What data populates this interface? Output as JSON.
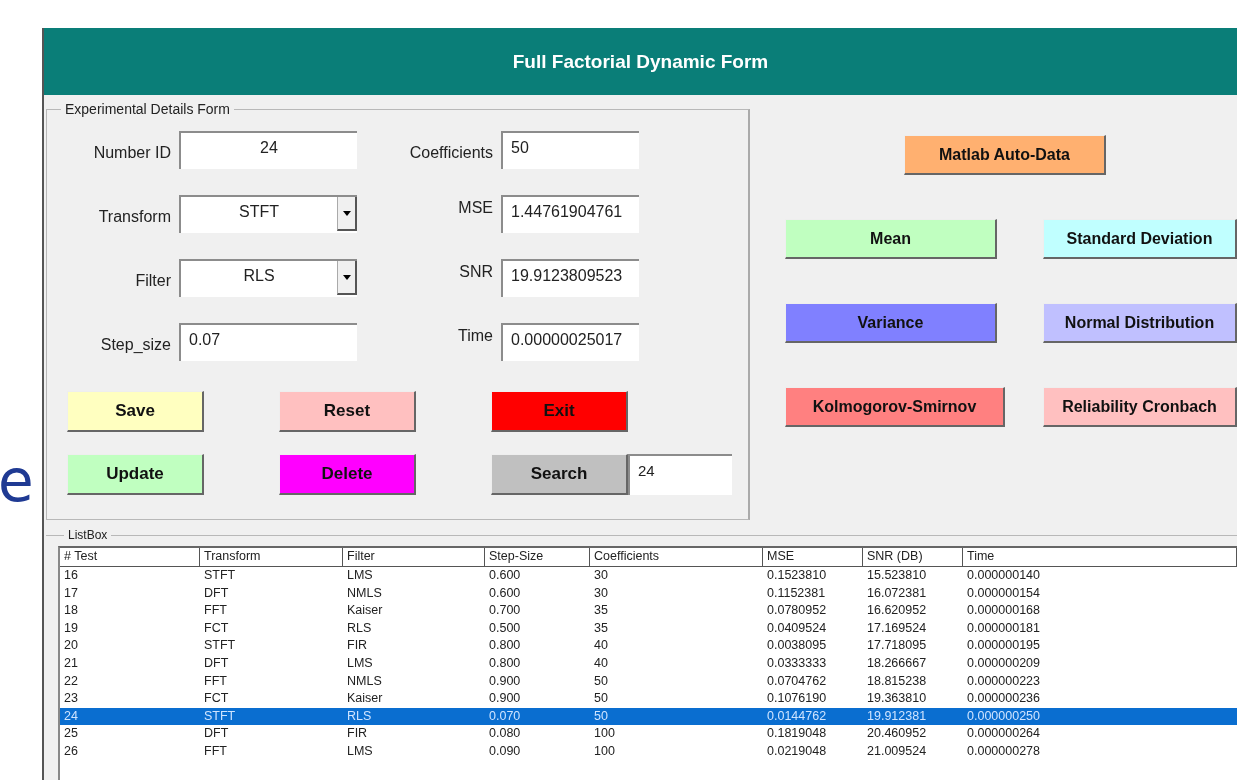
{
  "background_fragment": "e",
  "window": {
    "title": "Full Factorial Dynamic Form"
  },
  "form": {
    "legend": "Experimental Details Form",
    "fields": [
      {
        "label": "Number ID",
        "kind": "centered",
        "value": "24"
      },
      {
        "label": "Coefficients",
        "kind": "text",
        "value": "50"
      },
      {
        "label": "Transform",
        "kind": "dropdown",
        "value": "STFT"
      },
      {
        "label": "MSE",
        "kind": "text",
        "value": "1.44761904761"
      },
      {
        "label": "Filter",
        "kind": "dropdown",
        "value": "RLS"
      },
      {
        "label": "SNR",
        "kind": "text",
        "value": "19.9123809523"
      },
      {
        "label": "Step_size",
        "kind": "text",
        "value": "0.07"
      },
      {
        "label": "Time",
        "kind": "text",
        "value": "0.00000025017"
      }
    ],
    "buttons": [
      {
        "label": "Save",
        "color": "#ffffc0"
      },
      {
        "label": "Reset",
        "color": "#ffc0c0"
      },
      {
        "label": "Exit",
        "color": "#ff0000"
      },
      {
        "label": "Update",
        "color": "#c0ffc0"
      },
      {
        "label": "Delete",
        "color": "#ff00ff"
      },
      {
        "label": "Search",
        "color": "#c0c0c0"
      }
    ],
    "search_value": "24"
  },
  "analysis_buttons": [
    {
      "label": "Matlab Auto-Data",
      "color": "#ffb070"
    },
    {
      "label": "Mean",
      "color": "#c0ffc0"
    },
    {
      "label": "Standard Deviation",
      "color": "#c0ffff"
    },
    {
      "label": "Variance",
      "color": "#8080ff"
    },
    {
      "label": "Normal Distribution",
      "color": "#c0c0ff"
    },
    {
      "label": "Kolmogorov-Smirnov",
      "color": "#ff8080"
    },
    {
      "label": "Reliability Cronbach",
      "color": "#ffc0c0"
    }
  ],
  "listbox": {
    "legend": "ListBox",
    "columns": [
      "# Test",
      "Transform",
      "Filter",
      "Step-Size",
      "Coefficients",
      "MSE",
      "SNR (DB)",
      "Time"
    ],
    "rows": [
      {
        "cells": [
          "16",
          "STFT",
          "LMS",
          "0.600",
          "30",
          "0.1523810",
          "15.523810",
          "0.000000140"
        ],
        "selected": false
      },
      {
        "cells": [
          "17",
          "DFT",
          "NMLS",
          "0.600",
          "30",
          "0.1152381",
          "16.072381",
          "0.000000154"
        ],
        "selected": false
      },
      {
        "cells": [
          "18",
          "FFT",
          "Kaiser",
          "0.700",
          "35",
          "0.0780952",
          "16.620952",
          "0.000000168"
        ],
        "selected": false
      },
      {
        "cells": [
          "19",
          "FCT",
          "RLS",
          "0.500",
          "35",
          "0.0409524",
          "17.169524",
          "0.000000181"
        ],
        "selected": false
      },
      {
        "cells": [
          "20",
          "STFT",
          "FIR",
          "0.800",
          "40",
          "0.0038095",
          "17.718095",
          "0.000000195"
        ],
        "selected": false
      },
      {
        "cells": [
          "21",
          "DFT",
          "LMS",
          "0.800",
          "40",
          "0.0333333",
          "18.266667",
          "0.000000209"
        ],
        "selected": false
      },
      {
        "cells": [
          "22",
          "FFT",
          "NMLS",
          "0.900",
          "50",
          "0.0704762",
          "18.815238",
          "0.000000223"
        ],
        "selected": false
      },
      {
        "cells": [
          "23",
          "FCT",
          "Kaiser",
          "0.900",
          "50",
          "0.1076190",
          "19.363810",
          "0.000000236"
        ],
        "selected": false
      },
      {
        "cells": [
          "24",
          "STFT",
          "RLS",
          "0.070",
          "50",
          "0.0144762",
          "19.912381",
          "0.000000250"
        ],
        "selected": true
      },
      {
        "cells": [
          "25",
          "DFT",
          "FIR",
          "0.080",
          "100",
          "0.1819048",
          "20.460952",
          "0.000000264"
        ],
        "selected": false
      },
      {
        "cells": [
          "26",
          "FFT",
          "LMS",
          "0.090",
          "100",
          "0.0219048",
          "21.009524",
          "0.000000278"
        ],
        "selected": false
      }
    ]
  }
}
